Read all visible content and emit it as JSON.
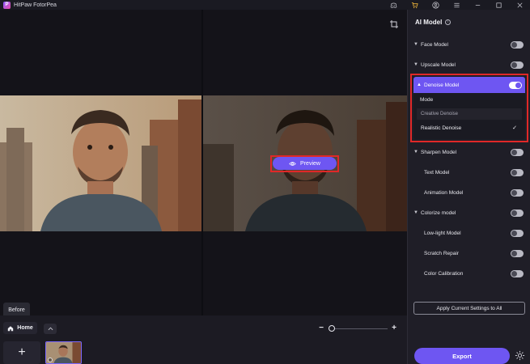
{
  "app": {
    "title": "HitPaw FotorPea",
    "logo_letter": "P"
  },
  "titlebar": {
    "icons": [
      "discord-icon",
      "cart-icon",
      "account-icon",
      "menu-icon",
      "minimize-icon",
      "maximize-icon",
      "close-icon"
    ]
  },
  "canvas": {
    "preview_label": "Preview",
    "before_label": "Before"
  },
  "bottombar": {
    "home_label": "Home",
    "zoom_minus": "−",
    "zoom_plus": "+",
    "add_label": "+"
  },
  "panel": {
    "title": "AI Model",
    "info": "i",
    "models": [
      {
        "label": "Face Model",
        "expandable": true,
        "on": false
      },
      {
        "label": "Upscale Model",
        "expandable": true,
        "on": false
      },
      {
        "label": "Denoise Model",
        "expandable": true,
        "on": true,
        "expanded": true
      },
      {
        "label": "Sharpen Model",
        "expandable": true,
        "on": false
      },
      {
        "label": "Text Model",
        "expandable": false,
        "on": false
      },
      {
        "label": "Animation Model",
        "expandable": false,
        "on": false
      },
      {
        "label": "Colorize model",
        "expandable": true,
        "on": false
      },
      {
        "label": "Low-light Model",
        "expandable": false,
        "on": false
      },
      {
        "label": "Scratch Repair",
        "expandable": false,
        "on": false
      },
      {
        "label": "Color Calibration",
        "expandable": false,
        "on": false
      }
    ],
    "denoise": {
      "mode_label": "Mode",
      "options": [
        "Creative Denoise",
        "Realistic Denoise"
      ],
      "selected": "Realistic Denoise",
      "check": "✓"
    },
    "apply_label": "Apply Current Settings to All",
    "export_label": "Export"
  },
  "colors": {
    "accent": "#6e56f2",
    "highlight": "#e02828",
    "background": "#18171f",
    "panel": "#1f1e27"
  }
}
